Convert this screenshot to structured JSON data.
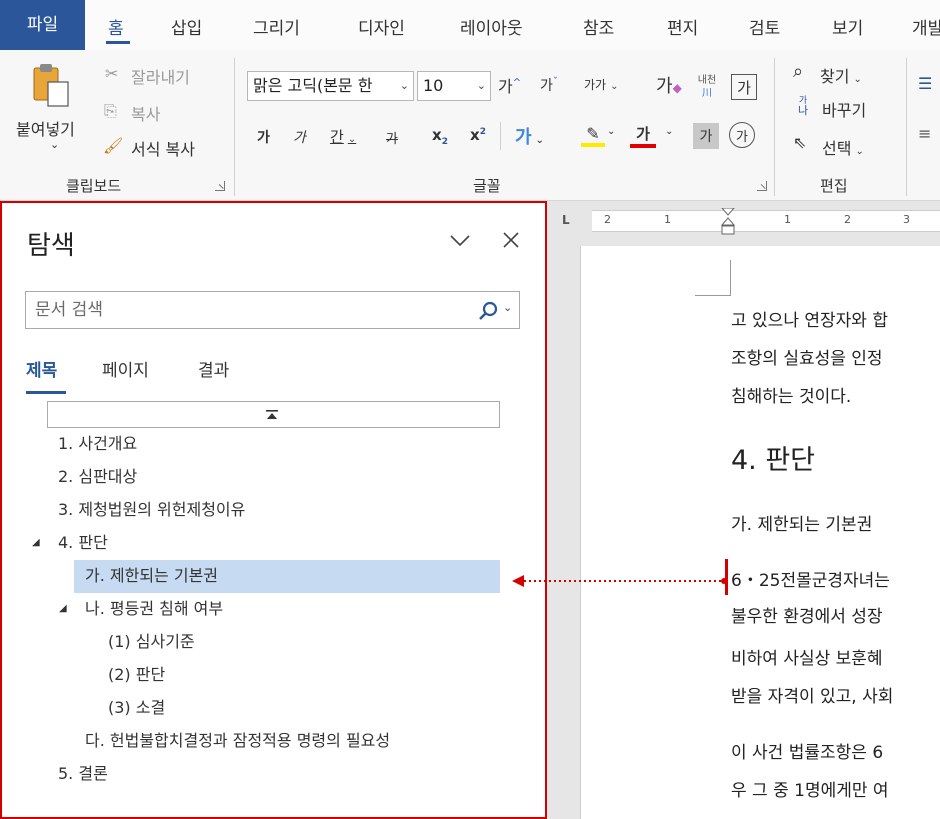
{
  "ribbon_tabs": {
    "file": "파일",
    "home": "홈",
    "insert": "삽입",
    "draw": "그리기",
    "design": "디자인",
    "layout": "레이아웃",
    "references": "참조",
    "mailings": "편지",
    "review": "검토",
    "view": "보기",
    "developer": "개발"
  },
  "clipboard": {
    "paste": "붙여넣기",
    "cut": "잘라내기",
    "copy": "복사",
    "format_painter": "서식 복사",
    "group_label": "클립보드"
  },
  "font": {
    "font_name": "맑은 고딕(본문 한",
    "font_size": "10",
    "grow": "가",
    "shrink": "가",
    "change_case": "가가",
    "clear_format": "가",
    "phonetic": "내천",
    "phonetic_sub": "川",
    "char_border": "가",
    "bold": "가",
    "italic": "가",
    "underline": "간",
    "strike": "가",
    "subscript": "x",
    "subscript_sub": "2",
    "superscript": "x",
    "superscript_sup": "2",
    "text_effects": "가",
    "font_color": "가",
    "char_shading": "가",
    "enclosed": "가",
    "group_label": "글꼴"
  },
  "editing": {
    "find": "찾기",
    "replace": "바꾸기",
    "replace_icon_top": "가",
    "replace_icon_bottom": "나",
    "select": "선택",
    "group_label": "편집"
  },
  "colors": {
    "accent": "#2b579a",
    "highlight_bar": "#ffeb00",
    "font_color_bar": "#e00000",
    "selection": "#c6daf1",
    "callout": "#d40000"
  },
  "nav": {
    "title": "탐색",
    "search_placeholder": "문서 검색",
    "tabs": [
      "제목",
      "페이지",
      "결과"
    ],
    "active_tab": "제목",
    "tree": [
      {
        "label": "1. 사건개요"
      },
      {
        "label": "2. 심판대상"
      },
      {
        "label": "3. 제청법원의 위헌제청이유"
      },
      {
        "label": "4. 판단",
        "expanded": true
      },
      {
        "label": "가. 제한되는 기본권",
        "selected": true
      },
      {
        "label": "나. 평등권 침해 여부",
        "expanded": true
      },
      {
        "label": "(1) 심사기준"
      },
      {
        "label": "(2) 판단"
      },
      {
        "label": "(3) 소결"
      },
      {
        "label": "다. 헌법불합치결정과 잠정적용 명령의 필요성"
      },
      {
        "label": "5. 결론"
      }
    ]
  },
  "ruler": {
    "marks": [
      "2",
      "1",
      "1",
      "2",
      "3"
    ],
    "tab_marker": "L"
  },
  "document": {
    "lines": [
      "고 있으나 연장자와 합",
      "조항의 실효성을 인정",
      "침해하는 것이다."
    ],
    "heading": "4. 판단",
    "subheading": "가. 제한되는 기본권",
    "para1": [
      "6・25전몰군경자녀는",
      "불우한 환경에서 성장",
      "비하여 사실상 보훈혜",
      "받을 자격이 있고, 사회"
    ],
    "para2": [
      "이 사건 법률조항은 6",
      "우 그 중 1명에게만 여"
    ]
  }
}
